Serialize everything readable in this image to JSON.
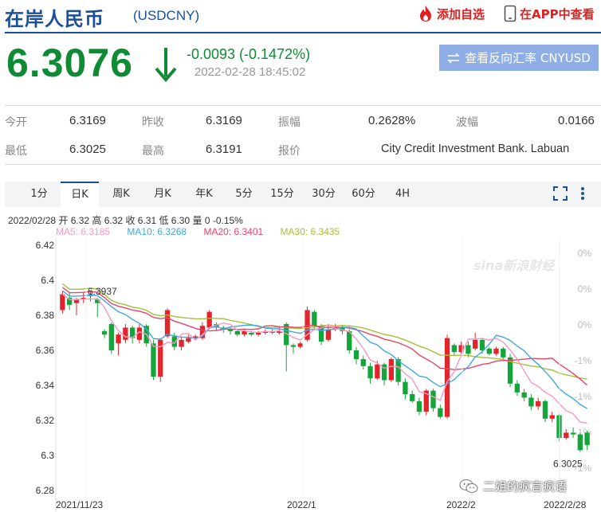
{
  "header": {
    "title": "在岸人民币",
    "code": "(USDCNY)",
    "add_fav": "添加自选",
    "app_view": "在APP中查看"
  },
  "price": {
    "value": "6.3076",
    "change": "-0.0093 (-0.1472%)",
    "timestamp": "2022-02-28 18:45:02",
    "reverse_button": "查看反向汇率 CNYUSD"
  },
  "quote": {
    "row1": [
      {
        "label": "今开",
        "value": "6.3169"
      },
      {
        "label": "昨收",
        "value": "6.3169"
      },
      {
        "label": "振幅",
        "value": "0.2628%"
      },
      {
        "label": "波幅",
        "value": "0.0166"
      }
    ],
    "row2": [
      {
        "label": "最低",
        "value": "6.3025"
      },
      {
        "label": "最高",
        "value": "6.3191"
      },
      {
        "label": "报价",
        "value": "City Credit Investment Bank. Labuan"
      }
    ]
  },
  "tabs": [
    "1分",
    "日K",
    "周K",
    "月K",
    "年K",
    "5分",
    "15分",
    "30分",
    "60分",
    "4H"
  ],
  "active_tab": "日K",
  "chart_info": {
    "line": "2022/02/28 开 6.32 高 6.32 收 6.31 低 6.30 量 0 -0.15%",
    "ma5": "MA5: 6.3185",
    "ma10": "MA10: 6.3268",
    "ma20": "MA20: 6.3401",
    "ma30": "MA30: 6.3435"
  },
  "colors": {
    "up": "#e0262b",
    "down": "#14a53a",
    "ma5": "#f598c4",
    "ma10": "#3fa8e0",
    "ma20": "#e8446a",
    "ma30": "#a6bf3a",
    "accent": "#1a4f9c"
  },
  "watermark": "sina新浪财经",
  "wechat_label": "二姐的疯言疯语",
  "chart_data": {
    "type": "candlestick",
    "ylim": [
      6.28,
      6.42
    ],
    "y_ticks": [
      "6.42",
      "6.4",
      "6.38",
      "6.36",
      "6.34",
      "6.32",
      "6.3",
      "6.28"
    ],
    "right_ticks": [
      "0%",
      "0%",
      "0%",
      "-1%",
      "-1%",
      "-1%",
      "-1%"
    ],
    "x_labels": [
      "2021/11/23",
      "2022/1",
      "2022/2",
      "2022/2/28"
    ],
    "annotations": [
      {
        "text": "6.3937",
        "value": 6.3937
      },
      {
        "text": "6.3025",
        "value": 6.3025
      }
    ],
    "candles": [
      [
        6.383,
        6.392,
        6.394,
        6.381
      ],
      [
        6.39,
        6.386,
        6.393,
        6.383
      ],
      [
        6.387,
        6.389,
        6.39,
        6.38
      ],
      [
        6.389,
        6.39,
        6.393,
        6.387
      ],
      [
        6.391,
        6.392,
        6.394,
        6.388
      ],
      [
        6.389,
        6.387,
        6.39,
        6.379
      ],
      [
        6.371,
        6.369,
        6.372,
        6.367
      ],
      [
        6.375,
        6.36,
        6.376,
        6.358
      ],
      [
        6.364,
        6.369,
        6.37,
        6.357
      ],
      [
        6.366,
        6.373,
        6.375,
        6.364
      ],
      [
        6.373,
        6.367,
        6.374,
        6.364
      ],
      [
        6.366,
        6.373,
        6.375,
        6.364
      ],
      [
        6.374,
        6.364,
        6.375,
        6.362
      ],
      [
        6.364,
        6.345,
        6.366,
        6.343
      ],
      [
        6.345,
        6.366,
        6.367,
        6.342
      ],
      [
        6.368,
        6.383,
        6.384,
        6.367
      ],
      [
        6.368,
        6.362,
        6.37,
        6.36
      ],
      [
        6.362,
        6.366,
        6.368,
        6.36
      ],
      [
        6.365,
        6.367,
        6.369,
        6.364
      ],
      [
        6.367,
        6.368,
        6.369,
        6.366
      ],
      [
        6.367,
        6.374,
        6.376,
        6.366
      ],
      [
        6.373,
        6.382,
        6.383,
        6.372
      ],
      [
        6.375,
        6.373,
        6.376,
        6.371
      ],
      [
        6.373,
        6.372,
        6.374,
        6.37
      ],
      [
        6.372,
        6.371,
        6.373,
        6.369
      ],
      [
        6.371,
        6.369,
        6.372,
        6.368
      ],
      [
        6.369,
        6.371,
        6.372,
        6.368
      ],
      [
        6.37,
        6.369,
        6.371,
        6.368
      ],
      [
        6.369,
        6.37,
        6.371,
        6.368
      ],
      [
        6.37,
        6.371,
        6.372,
        6.369
      ],
      [
        6.371,
        6.37,
        6.372,
        6.369
      ],
      [
        6.37,
        6.371,
        6.373,
        6.369
      ],
      [
        6.375,
        6.363,
        6.376,
        6.348
      ],
      [
        6.363,
        6.362,
        6.364,
        6.358
      ],
      [
        6.362,
        6.364,
        6.365,
        6.361
      ],
      [
        6.366,
        6.383,
        6.385,
        6.365
      ],
      [
        6.382,
        6.374,
        6.383,
        6.372
      ],
      [
        6.374,
        6.365,
        6.375,
        6.363
      ],
      [
        6.366,
        6.372,
        6.374,
        6.365
      ],
      [
        6.372,
        6.373,
        6.375,
        6.371
      ],
      [
        6.373,
        6.371,
        6.374,
        6.369
      ],
      [
        6.371,
        6.36,
        6.372,
        6.358
      ],
      [
        6.36,
        6.355,
        6.362,
        6.352
      ],
      [
        6.355,
        6.351,
        6.357,
        6.349
      ],
      [
        6.351,
        6.344,
        6.353,
        6.341
      ],
      [
        6.344,
        6.352,
        6.354,
        6.343
      ],
      [
        6.352,
        6.343,
        6.353,
        6.34
      ],
      [
        6.343,
        6.355,
        6.356,
        6.342
      ],
      [
        6.355,
        6.342,
        6.356,
        6.34
      ],
      [
        6.342,
        6.335,
        6.344,
        6.332
      ],
      [
        6.335,
        6.331,
        6.337,
        6.33
      ],
      [
        6.331,
        6.325,
        6.333,
        6.323
      ],
      [
        6.325,
        6.337,
        6.338,
        6.323
      ],
      [
        6.337,
        6.327,
        6.338,
        6.325
      ],
      [
        6.327,
        6.322,
        6.329,
        6.321
      ],
      [
        6.322,
        6.367,
        6.369,
        6.321
      ],
      [
        6.363,
        6.359,
        6.364,
        6.357
      ],
      [
        6.359,
        6.363,
        6.365,
        6.358
      ],
      [
        6.363,
        6.358,
        6.365,
        6.356
      ],
      [
        6.361,
        6.366,
        6.37,
        6.36
      ],
      [
        6.366,
        6.36,
        6.367,
        6.358
      ],
      [
        6.361,
        6.358,
        6.362,
        6.357
      ],
      [
        6.358,
        6.361,
        6.362,
        6.357
      ],
      [
        6.361,
        6.356,
        6.362,
        6.355
      ],
      [
        6.356,
        6.341,
        6.358,
        6.339
      ],
      [
        6.341,
        6.336,
        6.343,
        6.334
      ],
      [
        6.336,
        6.333,
        6.338,
        6.331
      ],
      [
        6.333,
        6.328,
        6.335,
        6.326
      ],
      [
        6.328,
        6.331,
        6.333,
        6.326
      ],
      [
        6.331,
        6.321,
        6.332,
        6.319
      ],
      [
        6.321,
        6.323,
        6.325,
        6.319
      ],
      [
        6.323,
        6.31,
        6.324,
        6.308
      ],
      [
        6.31,
        6.313,
        6.315,
        6.309
      ],
      [
        6.313,
        6.312,
        6.316,
        6.31
      ],
      [
        6.312,
        6.303,
        6.313,
        6.302
      ],
      [
        6.313,
        6.306,
        6.314,
        6.303
      ]
    ],
    "ma5_end": 6.3185,
    "ma10_end": 6.3268,
    "ma20_end": 6.3401,
    "ma30_end": 6.3435
  }
}
